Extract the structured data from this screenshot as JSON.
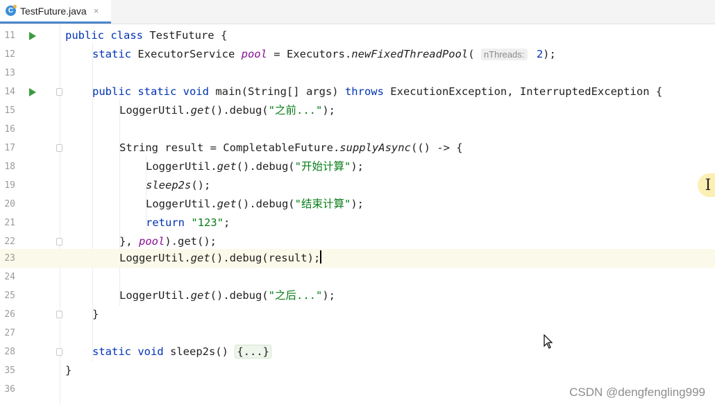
{
  "tab": {
    "title": "TestFuture.java",
    "icon": "java-class-icon",
    "close_glyph": "×"
  },
  "lines": [
    {
      "num": "11",
      "run": true
    },
    {
      "num": "12"
    },
    {
      "num": "13"
    },
    {
      "num": "14",
      "run": true,
      "fold": true
    },
    {
      "num": "15"
    },
    {
      "num": "16"
    },
    {
      "num": "17",
      "fold": true
    },
    {
      "num": "18"
    },
    {
      "num": "19"
    },
    {
      "num": "20"
    },
    {
      "num": "21"
    },
    {
      "num": "22",
      "fold": true
    },
    {
      "num": "23",
      "current": true
    },
    {
      "num": "24"
    },
    {
      "num": "25"
    },
    {
      "num": "26",
      "fold": true
    },
    {
      "num": "27"
    },
    {
      "num": "28",
      "fold": true
    },
    {
      "num": "35"
    },
    {
      "num": "36"
    }
  ],
  "code": {
    "l11": {
      "kw1": "public class",
      "rest": " TestFuture {"
    },
    "l12": {
      "kw1": "static",
      "type": " ExecutorService ",
      "field": "pool",
      "mid": " = Executors.",
      "method": "newFixedThreadPool",
      "open": "( ",
      "hint": "nThreads:",
      "arg": " 2",
      "close": ");"
    },
    "l14": {
      "kw1": "public static void",
      "sig": " main(String[] args) ",
      "kw2": "throws",
      "rest": " ExecutionException, InterruptedException {"
    },
    "l15": {
      "pre": "LoggerUtil.",
      "m": "get",
      "mid": "().debug(",
      "str": "\"之前...\"",
      "end": ");"
    },
    "l17": {
      "pre": "String result = CompletableFuture.",
      "m": "supplyAsync",
      "end": "(() -> {"
    },
    "l18": {
      "pre": "LoggerUtil.",
      "m": "get",
      "mid": "().debug(",
      "str": "\"开始计算\"",
      "end": ");"
    },
    "l19": {
      "m": "sleep2s",
      "end": "();"
    },
    "l20": {
      "pre": "LoggerUtil.",
      "m": "get",
      "mid": "().debug(",
      "str": "\"结束计算\"",
      "end": ");"
    },
    "l21": {
      "kw": "return",
      "str": " \"123\"",
      "end": ";"
    },
    "l22": {
      "pre": "}, ",
      "field": "pool",
      "end": ").get();"
    },
    "l23": {
      "pre": "LoggerUtil.",
      "m": "get",
      "mid": "().debug(result);"
    },
    "l25": {
      "pre": "LoggerUtil.",
      "m": "get",
      "mid": "().debug(",
      "str": "\"之后...\"",
      "end": ");"
    },
    "l26": {
      "text": "}"
    },
    "l28": {
      "kw": "static void",
      "rest": " sleep2s() ",
      "folded": "{...}"
    },
    "l35": {
      "text": "}"
    }
  },
  "overlay": {
    "text_cursor_glyph": "I"
  },
  "watermark": "CSDN @dengfengling999",
  "colors": {
    "keyword": "#0033b3",
    "field": "#871094",
    "string": "#067d17",
    "current_line": "#fbf9e9"
  }
}
